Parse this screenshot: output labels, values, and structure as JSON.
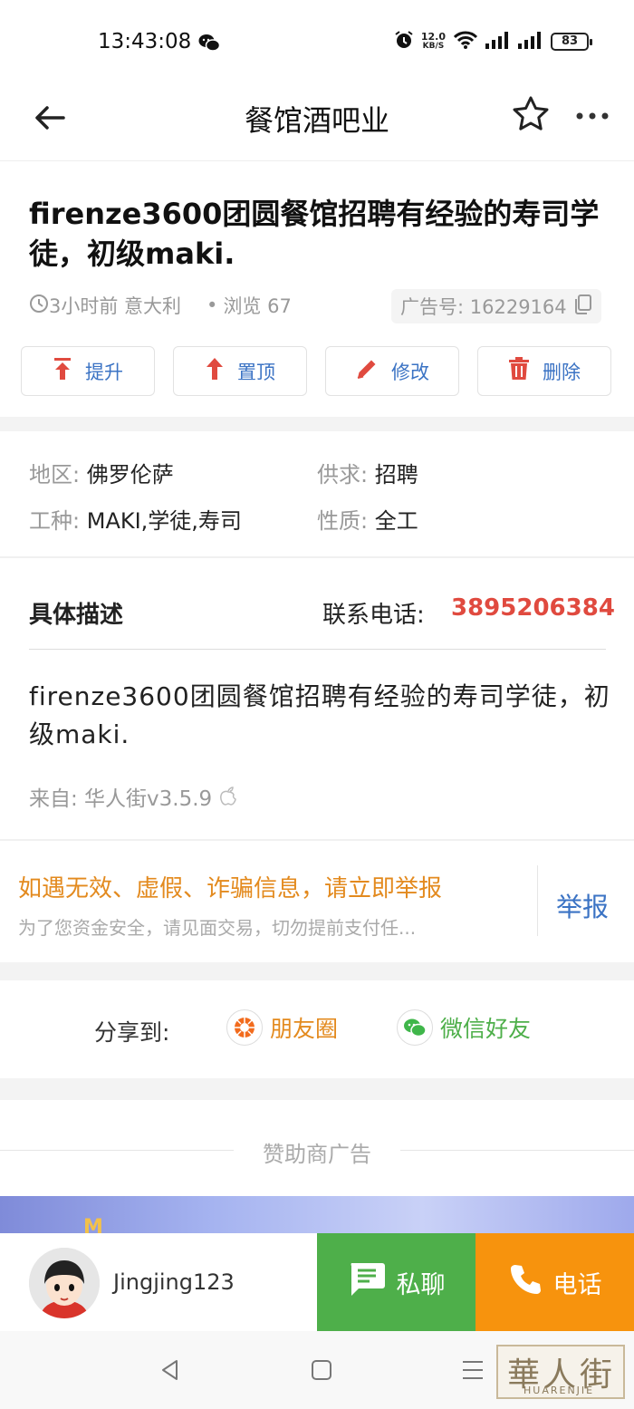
{
  "status_bar": {
    "time": "13:43:08",
    "speed_value": "12.0",
    "speed_unit": "KB/S",
    "battery": "83"
  },
  "nav": {
    "title": "餐馆酒吧业"
  },
  "post": {
    "title": "firenze3600团圆餐馆招聘有经验的寿司学徒，初级maki.",
    "time_location": "3小时前 意大利",
    "views": "浏览 67",
    "ad_number": "广告号: 16229164"
  },
  "actions": [
    {
      "label": "提升"
    },
    {
      "label": "置顶"
    },
    {
      "label": "修改"
    },
    {
      "label": "删除"
    }
  ],
  "info": {
    "region_label": "地区:",
    "region_value": "佛罗伦萨",
    "supply_label": "供求:",
    "supply_value": "招聘",
    "job_label": "工种:",
    "job_value": "MAKI,学徒,寿司",
    "nature_label": "性质:",
    "nature_value": "全工"
  },
  "description": {
    "label": "具体描述",
    "phone_label": "联系电话:",
    "phone_number": "3895206384",
    "text": "firenze3600团圆餐馆招聘有经验的寿司学徒，初级maki.",
    "from": "来自: 华人街v3.5.9"
  },
  "report": {
    "main": "如遇无效、虚假、诈骗信息，请立即举报",
    "sub": "为了您资金安全，请见面交易，切勿提前支付任...",
    "button": "举报"
  },
  "share": {
    "label": "分享到:",
    "moments": "朋友圈",
    "wechat": "微信好友"
  },
  "sponsor": {
    "label": "赞助商广告"
  },
  "bottom": {
    "username": "Jingjing123",
    "chat": "私聊",
    "call": "电话"
  },
  "watermark": {
    "cn": "華人街",
    "en": "HUARENJIE"
  },
  "colors": {
    "accent_blue": "#3b73c4",
    "accent_red": "#e04a3f",
    "report_orange": "#e38a1e",
    "chat_green": "#4eaf4a",
    "call_orange": "#f7930d"
  }
}
